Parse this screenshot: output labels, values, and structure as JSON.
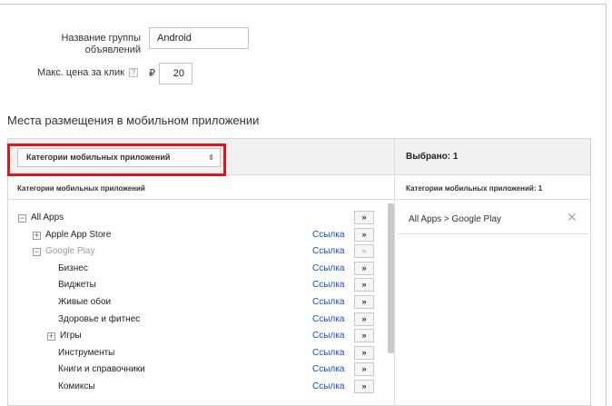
{
  "form": {
    "group_name_label_line1": "Название группы",
    "group_name_label_line2": "объявлений",
    "group_name_value": "Android",
    "max_cpc_label": "Макс. цена за клик",
    "help_glyph": "?",
    "currency_symbol": "₽",
    "max_cpc_value": "20"
  },
  "section": {
    "title": "Места размещения в мобильном приложении"
  },
  "left_panel": {
    "dropdown_value": "Категории мобильных приложений",
    "dropdown_arrows": "⇕",
    "column_header": "Категории мобильных приложений"
  },
  "right_panel": {
    "selected_title": "Выбрано: 1",
    "column_header": "Категории мобильных приложений: 1",
    "items": [
      {
        "label": "All Apps > Google Play",
        "remove_glyph": "✕"
      }
    ]
  },
  "tree": {
    "add_glyph": "»",
    "rows": [
      {
        "label": "All Apps",
        "expander": "−",
        "link": "",
        "muted": false,
        "disabled": false
      },
      {
        "label": "Apple App Store",
        "expander": "+",
        "link": "Ссылка",
        "muted": false,
        "disabled": false
      },
      {
        "label": "Google Play",
        "expander": "−",
        "link": "Ссылка",
        "muted": true,
        "disabled": true
      },
      {
        "label": "Бизнес",
        "expander": "",
        "link": "Ссылка",
        "muted": false,
        "disabled": false
      },
      {
        "label": "Виджеты",
        "expander": "",
        "link": "Ссылка",
        "muted": false,
        "disabled": false
      },
      {
        "label": "Живые обои",
        "expander": "",
        "link": "Ссылка",
        "muted": false,
        "disabled": false
      },
      {
        "label": "Здоровье и фитнес",
        "expander": "",
        "link": "Ссылка",
        "muted": false,
        "disabled": false
      },
      {
        "label": "Игры",
        "expander": "+",
        "link": "Ссылка",
        "muted": false,
        "disabled": false
      },
      {
        "label": "Инструменты",
        "expander": "",
        "link": "Ссылка",
        "muted": false,
        "disabled": false
      },
      {
        "label": "Книги и справочники",
        "expander": "",
        "link": "Ссылка",
        "muted": false,
        "disabled": false
      },
      {
        "label": "Комиксы",
        "expander": "",
        "link": "Ссылка",
        "muted": false,
        "disabled": false
      }
    ]
  },
  "colors": {
    "highlight": "#e0151b",
    "link": "#1a4fc1"
  }
}
